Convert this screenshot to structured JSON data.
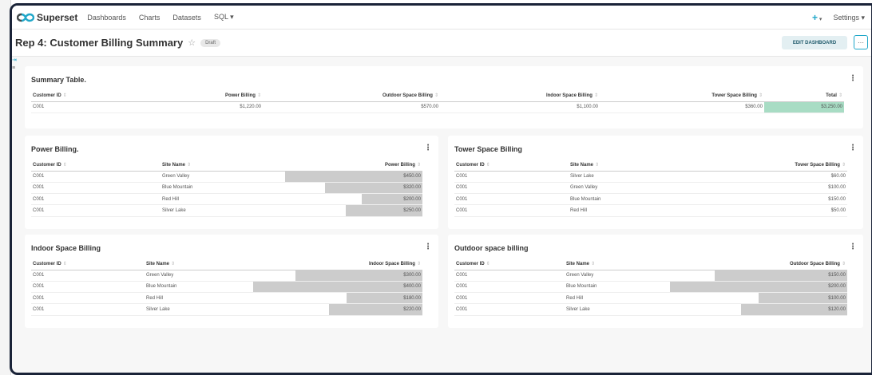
{
  "app": {
    "name": "Superset"
  },
  "nav": {
    "items": [
      "Dashboards",
      "Charts",
      "Datasets",
      "SQL ▾"
    ],
    "plus": "+",
    "settings": "Settings ▾"
  },
  "header": {
    "title": "Rep 4: Customer Billing Summary",
    "draft": "Draft",
    "edit_button": "EDIT DASHBOARD",
    "more": "···"
  },
  "colors": {
    "accent": "#20a7c9",
    "bar": "#cccccc",
    "total_highlight": "#a8dcc4"
  },
  "summary": {
    "title": "Summary Table.",
    "columns": [
      "Customer ID",
      "Power Billing",
      "Outdoor Space Billing",
      "Indoor Space Billing",
      "Tower Space Billing",
      "Total"
    ],
    "rows": [
      [
        "C001",
        "$1,220.00",
        "$570.00",
        "$1,100.00",
        "$360.00",
        "$3,250.00"
      ]
    ]
  },
  "power": {
    "title": "Power Billing.",
    "columns": [
      "Customer ID",
      "Site Name",
      "Power Billing"
    ],
    "rows": [
      {
        "customer": "C001",
        "site": "Green Valley",
        "value": "$450.00",
        "amount": 450
      },
      {
        "customer": "C001",
        "site": "Blue Mountain",
        "value": "$320.00",
        "amount": 320
      },
      {
        "customer": "C001",
        "site": "Red Hill",
        "value": "$200.00",
        "amount": 200
      },
      {
        "customer": "C001",
        "site": "Silver Lake",
        "value": "$250.00",
        "amount": 250
      }
    ]
  },
  "tower": {
    "title": "Tower Space Billing",
    "columns": [
      "Customer ID",
      "Site Name",
      "Tower Space Billing"
    ],
    "rows": [
      {
        "customer": "C001",
        "site": "Silver Lake",
        "value": "$60.00"
      },
      {
        "customer": "C001",
        "site": "Green Valley",
        "value": "$100.00"
      },
      {
        "customer": "C001",
        "site": "Blue Mountain",
        "value": "$150.00"
      },
      {
        "customer": "C001",
        "site": "Red Hill",
        "value": "$50.00"
      }
    ]
  },
  "indoor": {
    "title": "Indoor Space Billing",
    "columns": [
      "Customer ID",
      "Site Name",
      "Indoor Space Billing"
    ],
    "rows": [
      {
        "customer": "C001",
        "site": "Green Valley",
        "value": "$300.00",
        "amount": 300
      },
      {
        "customer": "C001",
        "site": "Blue Mountain",
        "value": "$400.00",
        "amount": 400
      },
      {
        "customer": "C001",
        "site": "Red Hill",
        "value": "$180.00",
        "amount": 180
      },
      {
        "customer": "C001",
        "site": "Silver Lake",
        "value": "$220.00",
        "amount": 220
      }
    ]
  },
  "outdoor": {
    "title": "Outdoor space billing",
    "columns": [
      "Customer ID",
      "Site Name",
      "Outdoor Space Billing"
    ],
    "rows": [
      {
        "customer": "C001",
        "site": "Green Valley",
        "value": "$150.00",
        "amount": 150
      },
      {
        "customer": "C001",
        "site": "Blue Mountain",
        "value": "$200.00",
        "amount": 200
      },
      {
        "customer": "C001",
        "site": "Red Hill",
        "value": "$100.00",
        "amount": 100
      },
      {
        "customer": "C001",
        "site": "Silver Lake",
        "value": "$120.00",
        "amount": 120
      }
    ]
  }
}
